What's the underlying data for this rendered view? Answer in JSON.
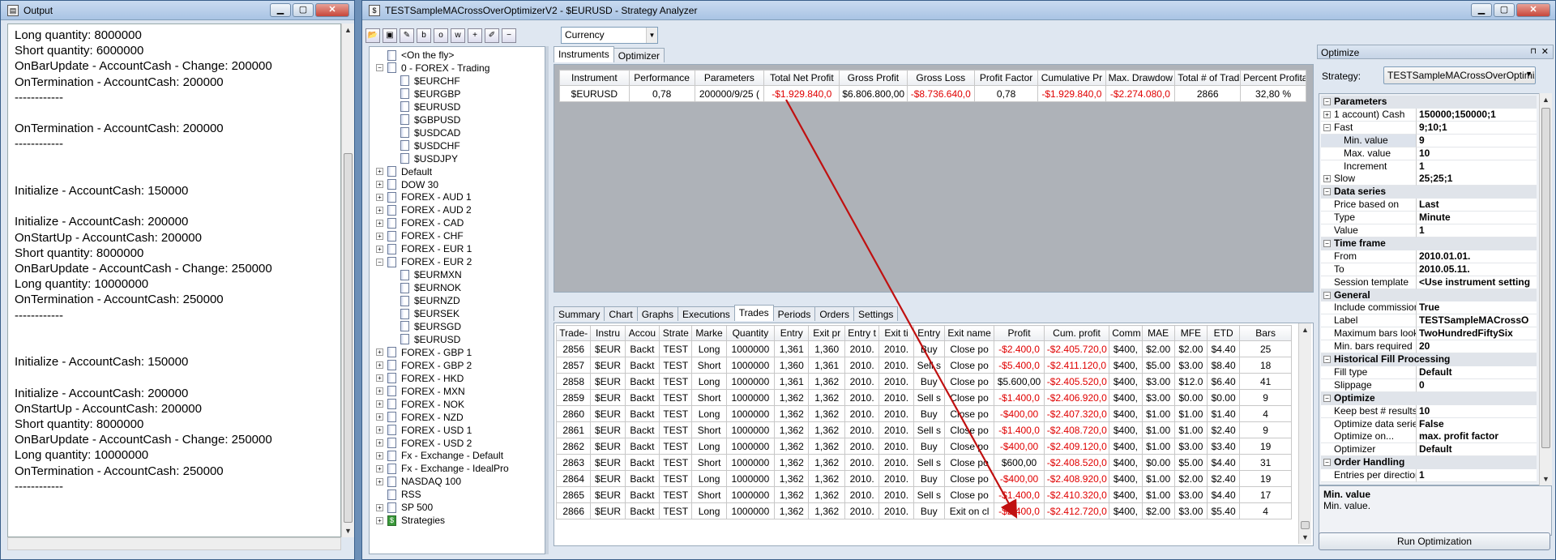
{
  "output": {
    "title": "Output",
    "lines": "Long quantity: 8000000\nShort quantity: 6000000\nOnBarUpdate - AccountCash - Change: 200000\nOnTermination - AccountCash: 200000\n------------\n\nOnTermination - AccountCash: 200000\n------------\n\n\nInitialize - AccountCash: 150000\n\nInitialize - AccountCash: 200000\nOnStartUp - AccountCash: 200000\nShort quantity: 8000000\nOnBarUpdate - AccountCash - Change: 250000\nLong quantity: 10000000\nOnTermination - AccountCash: 250000\n------------\n\n\nInitialize - AccountCash: 150000\n\nInitialize - AccountCash: 200000\nOnStartUp - AccountCash: 200000\nShort quantity: 8000000\nOnBarUpdate - AccountCash - Change: 250000\nLong quantity: 10000000\nOnTermination - AccountCash: 250000\n------------"
  },
  "analyzer": {
    "title": "TESTSampleMACrossOverOptimizerV2 - $EURUSD - Strategy Analyzer",
    "combo": "Currency"
  },
  "tree": [
    {
      "label": "<On the fly>",
      "level": 1,
      "exp": ""
    },
    {
      "label": "0 - FOREX - Trading",
      "level": 0,
      "exp": "−"
    },
    {
      "label": "$EURCHF",
      "level": 2,
      "exp": ""
    },
    {
      "label": "$EURGBP",
      "level": 2,
      "exp": ""
    },
    {
      "label": "$EURUSD",
      "level": 2,
      "exp": ""
    },
    {
      "label": "$GBPUSD",
      "level": 2,
      "exp": ""
    },
    {
      "label": "$USDCAD",
      "level": 2,
      "exp": ""
    },
    {
      "label": "$USDCHF",
      "level": 2,
      "exp": ""
    },
    {
      "label": "$USDJPY",
      "level": 2,
      "exp": ""
    },
    {
      "label": "Default",
      "level": 0,
      "exp": "+"
    },
    {
      "label": "DOW 30",
      "level": 0,
      "exp": "+"
    },
    {
      "label": "FOREX - AUD 1",
      "level": 0,
      "exp": "+"
    },
    {
      "label": "FOREX - AUD 2",
      "level": 0,
      "exp": "+"
    },
    {
      "label": "FOREX - CAD",
      "level": 0,
      "exp": "+"
    },
    {
      "label": "FOREX - CHF",
      "level": 0,
      "exp": "+"
    },
    {
      "label": "FOREX - EUR 1",
      "level": 0,
      "exp": "+"
    },
    {
      "label": "FOREX - EUR 2",
      "level": 0,
      "exp": "−"
    },
    {
      "label": "$EURMXN",
      "level": 2,
      "exp": ""
    },
    {
      "label": "$EURNOK",
      "level": 2,
      "exp": ""
    },
    {
      "label": "$EURNZD",
      "level": 2,
      "exp": ""
    },
    {
      "label": "$EURSEK",
      "level": 2,
      "exp": ""
    },
    {
      "label": "$EURSGD",
      "level": 2,
      "exp": ""
    },
    {
      "label": "$EURUSD",
      "level": 2,
      "exp": ""
    },
    {
      "label": "FOREX - GBP 1",
      "level": 0,
      "exp": "+"
    },
    {
      "label": "FOREX - GBP 2",
      "level": 0,
      "exp": "+"
    },
    {
      "label": "FOREX - HKD",
      "level": 0,
      "exp": "+"
    },
    {
      "label": "FOREX - MXN",
      "level": 0,
      "exp": "+"
    },
    {
      "label": "FOREX - NOK",
      "level": 0,
      "exp": "+"
    },
    {
      "label": "FOREX - NZD",
      "level": 0,
      "exp": "+"
    },
    {
      "label": "FOREX - USD 1",
      "level": 0,
      "exp": "+"
    },
    {
      "label": "FOREX - USD 2",
      "level": 0,
      "exp": "+"
    },
    {
      "label": "Fx - Exchange - Default",
      "level": 0,
      "exp": "+"
    },
    {
      "label": "Fx - Exchange - IdealPro",
      "level": 0,
      "exp": "+"
    },
    {
      "label": "NASDAQ 100",
      "level": 0,
      "exp": "+"
    },
    {
      "label": "RSS",
      "level": 0,
      "exp": ""
    },
    {
      "label": "SP 500",
      "level": 0,
      "exp": "+"
    },
    {
      "label": "Strategies",
      "level": 0,
      "exp": "+",
      "strat": true
    }
  ],
  "top_tabs": [
    "Instruments",
    "Optimizer"
  ],
  "instr_table": {
    "headers": [
      "Instrument",
      "Performance",
      "Parameters",
      "Total Net Profit",
      "Gross Profit",
      "Gross Loss",
      "Profit Factor",
      "Cumulative Pr",
      "Max. Drawdow",
      "Total # of Trad",
      "Percent Profitabl"
    ],
    "row": [
      "$EURUSD",
      "0,78",
      "200000/9/25 (",
      "-$1.929.840,0",
      "$6.806.800,00",
      "-$8.736.640,0",
      "0,78",
      "-$1.929.840,0",
      "-$2.274.080,0",
      "2866",
      "32,80 %"
    ]
  },
  "bottom_tabs": [
    "Summary",
    "Chart",
    "Graphs",
    "Executions",
    "Trades",
    "Periods",
    "Orders",
    "Settings"
  ],
  "trades": {
    "headers": [
      "Trade-",
      "Instru",
      "Accou",
      "Strate",
      "Marke",
      "Quantity",
      "Entry",
      "Exit pr",
      "Entry t",
      "Exit ti",
      "Entry",
      "Exit name",
      "Profit",
      "Cum. profit",
      "Comm",
      "MAE",
      "MFE",
      "ETD",
      "Bars"
    ],
    "rows": [
      [
        "2856",
        "$EUR",
        "Backt",
        "TEST",
        "Long",
        "1000000",
        "1,361",
        "1,360",
        "2010.",
        "2010.",
        "Buy",
        "Close po",
        "-$2.400,0",
        "-$2.405.720,0",
        "$400,",
        "$2.00",
        "$2.00",
        "$4.40",
        "25"
      ],
      [
        "2857",
        "$EUR",
        "Backt",
        "TEST",
        "Short",
        "1000000",
        "1,360",
        "1,361",
        "2010.",
        "2010.",
        "Sell s",
        "Close po",
        "-$5.400,0",
        "-$2.411.120,0",
        "$400,",
        "$5.00",
        "$3.00",
        "$8.40",
        "18"
      ],
      [
        "2858",
        "$EUR",
        "Backt",
        "TEST",
        "Long",
        "1000000",
        "1,361",
        "1,362",
        "2010.",
        "2010.",
        "Buy",
        "Close po",
        "$5.600,00",
        "-$2.405.520,0",
        "$400,",
        "$3.00",
        "$12.0",
        "$6.40",
        "41"
      ],
      [
        "2859",
        "$EUR",
        "Backt",
        "TEST",
        "Short",
        "1000000",
        "1,362",
        "1,362",
        "2010.",
        "2010.",
        "Sell s",
        "Close po",
        "-$1.400,0",
        "-$2.406.920,0",
        "$400,",
        "$3.00",
        "$0.00",
        "$0.00",
        "9"
      ],
      [
        "2860",
        "$EUR",
        "Backt",
        "TEST",
        "Long",
        "1000000",
        "1,362",
        "1,362",
        "2010.",
        "2010.",
        "Buy",
        "Close po",
        "-$400,00",
        "-$2.407.320,0",
        "$400,",
        "$1.00",
        "$1.00",
        "$1.40",
        "4"
      ],
      [
        "2861",
        "$EUR",
        "Backt",
        "TEST",
        "Short",
        "1000000",
        "1,362",
        "1,362",
        "2010.",
        "2010.",
        "Sell s",
        "Close po",
        "-$1.400,0",
        "-$2.408.720,0",
        "$400,",
        "$1.00",
        "$1.00",
        "$2.40",
        "9"
      ],
      [
        "2862",
        "$EUR",
        "Backt",
        "TEST",
        "Long",
        "1000000",
        "1,362",
        "1,362",
        "2010.",
        "2010.",
        "Buy",
        "Close po",
        "-$400,00",
        "-$2.409.120,0",
        "$400,",
        "$1.00",
        "$3.00",
        "$3.40",
        "19"
      ],
      [
        "2863",
        "$EUR",
        "Backt",
        "TEST",
        "Short",
        "1000000",
        "1,362",
        "1,362",
        "2010.",
        "2010.",
        "Sell s",
        "Close po",
        "$600,00",
        "-$2.408.520,0",
        "$400,",
        "$0.00",
        "$5.00",
        "$4.40",
        "31"
      ],
      [
        "2864",
        "$EUR",
        "Backt",
        "TEST",
        "Long",
        "1000000",
        "1,362",
        "1,362",
        "2010.",
        "2010.",
        "Buy",
        "Close po",
        "-$400,00",
        "-$2.408.920,0",
        "$400,",
        "$1.00",
        "$2.00",
        "$2.40",
        "19"
      ],
      [
        "2865",
        "$EUR",
        "Backt",
        "TEST",
        "Short",
        "1000000",
        "1,362",
        "1,362",
        "2010.",
        "2010.",
        "Sell s",
        "Close po",
        "-$1.400,0",
        "-$2.410.320,0",
        "$400,",
        "$1.00",
        "$3.00",
        "$4.40",
        "17"
      ],
      [
        "2866",
        "$EUR",
        "Backt",
        "TEST",
        "Long",
        "1000000",
        "1,362",
        "1,362",
        "2010.",
        "2010.",
        "Buy",
        "Exit on cl",
        "-$2.400,0",
        "-$2.412.720,0",
        "$400,",
        "$2.00",
        "$3.00",
        "$5.40",
        "4"
      ]
    ]
  },
  "optimize": {
    "title": "Optimize",
    "strategy_label": "Strategy:",
    "strategy_value": "TESTSampleMACrossOverOptimize",
    "props": [
      {
        "cat": true,
        "k": "Parameters",
        "exp": "−"
      },
      {
        "k": "1 account) Cash",
        "v": "150000;150000;1",
        "exp": "+"
      },
      {
        "k": "Fast",
        "v": "9;10;1",
        "exp": "−"
      },
      {
        "k": "Min. value",
        "v": "9",
        "sub": true,
        "sel": true
      },
      {
        "k": "Max. value",
        "v": "10",
        "sub": true
      },
      {
        "k": "Increment",
        "v": "1",
        "sub": true
      },
      {
        "k": "Slow",
        "v": "25;25;1",
        "exp": "+"
      },
      {
        "cat": true,
        "k": "Data series",
        "exp": "−"
      },
      {
        "k": "Price based on",
        "v": "Last"
      },
      {
        "k": "Type",
        "v": "Minute"
      },
      {
        "k": "Value",
        "v": "1"
      },
      {
        "cat": true,
        "k": "Time frame",
        "exp": "−"
      },
      {
        "k": "From",
        "v": "2010.01.01."
      },
      {
        "k": "To",
        "v": "2010.05.11."
      },
      {
        "k": "Session template",
        "v": "<Use instrument setting"
      },
      {
        "cat": true,
        "k": "General",
        "exp": "−"
      },
      {
        "k": "Include commission",
        "v": "True"
      },
      {
        "k": "Label",
        "v": "TESTSampleMACrossO"
      },
      {
        "k": "Maximum bars look bac",
        "v": "TwoHundredFiftySix"
      },
      {
        "k": "Min. bars required",
        "v": "20"
      },
      {
        "cat": true,
        "k": "Historical Fill Processing",
        "exp": "−"
      },
      {
        "k": "Fill type",
        "v": "Default"
      },
      {
        "k": "Slippage",
        "v": "0"
      },
      {
        "cat": true,
        "k": "Optimize",
        "exp": "−"
      },
      {
        "k": "Keep best # results",
        "v": "10"
      },
      {
        "k": "Optimize data series",
        "v": "False"
      },
      {
        "k": "Optimize on...",
        "v": "max. profit factor"
      },
      {
        "k": "Optimizer",
        "v": "Default"
      },
      {
        "cat": true,
        "k": "Order Handling",
        "exp": "−"
      },
      {
        "k": "Entries per direction",
        "v": "1"
      }
    ],
    "help_title": "Min. value",
    "help_text": "Min. value.",
    "run_button": "Run Optimization"
  }
}
